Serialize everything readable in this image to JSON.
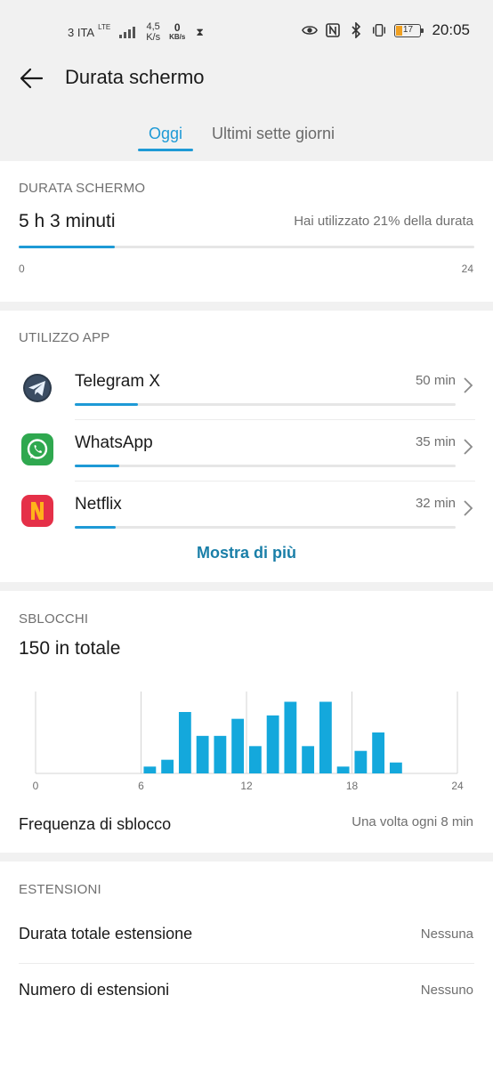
{
  "status_bar": {
    "carrier": "3 ITA",
    "network": "LTE",
    "speed_value": "4,5",
    "speed_unit": "K/s",
    "data_value": "0",
    "data_unit": "KB/s",
    "battery": "17",
    "time": "20:05"
  },
  "header": {
    "title": "Durata schermo",
    "back_icon": "arrow-left-icon"
  },
  "tabs": [
    {
      "label": "Oggi",
      "active": true
    },
    {
      "label": "Ultimi sette giorni",
      "active": false
    }
  ],
  "screen_time": {
    "section_label": "DURATA SCHERMO",
    "total": "5 h 3 minuti",
    "note": "Hai utilizzato 21% della durata",
    "progress_fraction": 0.21,
    "axis_min": "0",
    "axis_max": "24"
  },
  "app_usage": {
    "section_label": "UTILIZZO APP",
    "apps": [
      {
        "name": "Telegram X",
        "time": "50 min",
        "minutes": 50,
        "icon": "telegram-x-icon"
      },
      {
        "name": "WhatsApp",
        "time": "35 min",
        "minutes": 35,
        "icon": "whatsapp-icon"
      },
      {
        "name": "Netflix",
        "time": "32 min",
        "minutes": 32,
        "icon": "netflix-icon"
      }
    ],
    "more_label": "Mostra di più"
  },
  "unlocks": {
    "section_label": "SBLOCCHI",
    "total": "150 in totale",
    "frequency_label": "Frequenza di sblocco",
    "frequency_value": "Una volta ogni 8 min"
  },
  "chart_data": {
    "type": "bar",
    "x_ticks": [
      "0",
      "6",
      "12",
      "18",
      "24"
    ],
    "x": [
      6.5,
      7.5,
      8.5,
      9.5,
      10.5,
      11.5,
      12.5,
      13.5,
      14.5,
      15.5,
      16.5,
      17.5,
      18.5,
      19.5,
      20.5
    ],
    "values": [
      1,
      2,
      9,
      5.5,
      5.5,
      8,
      4,
      8.5,
      10.5,
      4,
      10.5,
      1,
      3.3,
      6,
      1.6
    ],
    "xlim": [
      0,
      24
    ],
    "ylim": [
      0,
      12
    ],
    "bar_color": "#14a8dc",
    "grid": "vertical"
  },
  "extensions": {
    "section_label": "ESTENSIONI",
    "rows": [
      {
        "label": "Durata totale estensione",
        "value": "Nessuna"
      },
      {
        "label": "Numero di estensioni",
        "value": "Nessuno"
      }
    ]
  },
  "colors": {
    "accent": "#1e9ad6",
    "link": "#1a7fa8"
  }
}
